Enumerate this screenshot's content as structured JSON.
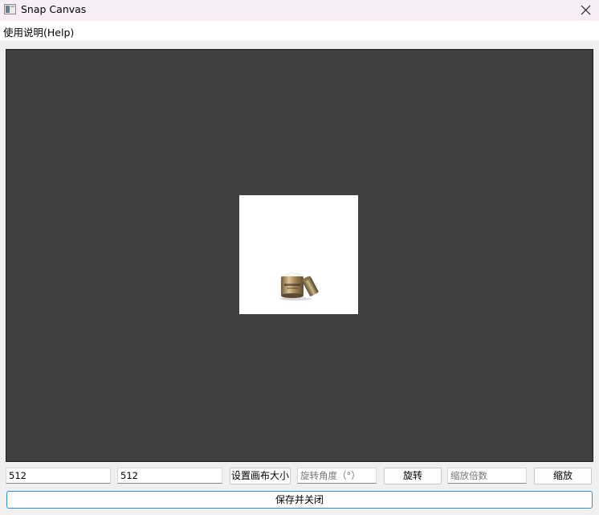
{
  "window": {
    "title": "Snap Canvas"
  },
  "menu": {
    "help": "使用说明(Help)"
  },
  "controls": {
    "width_value": "512",
    "height_value": "512",
    "set_canvas_size_label": "设置画布大小",
    "rotate_angle_placeholder": "旋转角度（°）",
    "rotate_label": "旋转",
    "scale_placeholder": "缩放倍数",
    "scale_label": "缩放",
    "save_close_label": "保存并关闭"
  },
  "colors": {
    "canvas_bg": "#404040",
    "titlebar_bg": "#f7eff5",
    "accent_border": "#2f8fd8"
  }
}
